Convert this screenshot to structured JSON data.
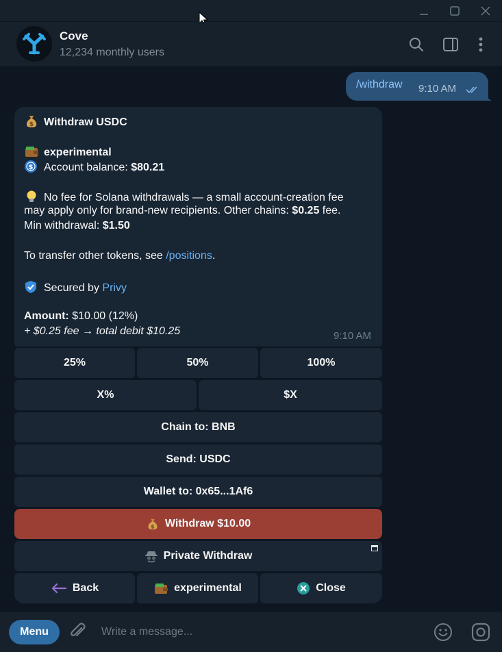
{
  "window": {
    "controls": [
      "minimize-icon",
      "maximize-icon",
      "close-icon"
    ]
  },
  "header": {
    "title": "Cove",
    "subtitle": "12,234 monthly users",
    "icons": [
      "search-icon",
      "sidebar-toggle-icon",
      "more-vertical-icon"
    ]
  },
  "chat": {
    "outgoing": {
      "text": "/withdraw",
      "time": "9:10 AM",
      "status_icon": "double-check-icon"
    },
    "incoming": {
      "title": "Withdraw USDC",
      "wallet_name": "experimental",
      "balance_label": "Account balance: ",
      "balance_value": "$80.21",
      "fee_line1": "No fee for Solana withdrawals — a small account-creation fee",
      "fee_line2_a": "may apply only for brand-new recipients. Other chains: ",
      "fee_line2_b": "$0.25",
      "fee_line2_c": " fee.",
      "min_label": "Min withdrawal: ",
      "min_value": "$1.50",
      "transfer_a": "To transfer other tokens, see ",
      "transfer_link": "/positions",
      "transfer_b": ".",
      "secured_a": "Secured by ",
      "secured_link": "Privy",
      "amount_label": "Amount:",
      "amount_value": " $10.00 (12%)",
      "debit_line": "+ $0.25 fee → total debit $10.25",
      "time": "9:10 AM",
      "icons": [
        "money-bag-icon",
        "wallet-icon",
        "usdc-coin-icon",
        "lightbulb-icon",
        "shield-icon"
      ]
    }
  },
  "keyboard": {
    "pct25": "25%",
    "pct50": "50%",
    "pct100": "100%",
    "xpct": "X%",
    "xusd": "$X",
    "chain": "Chain to: BNB",
    "send": "Send: USDC",
    "wallet": "Wallet to: 0x65...1Af6",
    "withdraw": "Withdraw $10.00",
    "private": "Private Withdraw",
    "back": "Back",
    "experimental": "experimental",
    "close": "Close"
  },
  "input": {
    "menu_label": "Menu",
    "placeholder": "Write a message...",
    "icons": [
      "paperclip-icon",
      "emoji-icon",
      "camera-icon"
    ]
  },
  "colors": {
    "background": "#0e1621",
    "header": "#17212b",
    "bubble_out": "#2b5278",
    "bubble_in": "#182533",
    "button": "#1a2634",
    "withdraw_button": "#9b3f35",
    "link": "#6ab3f3",
    "menu_button": "#2f6ea5"
  }
}
